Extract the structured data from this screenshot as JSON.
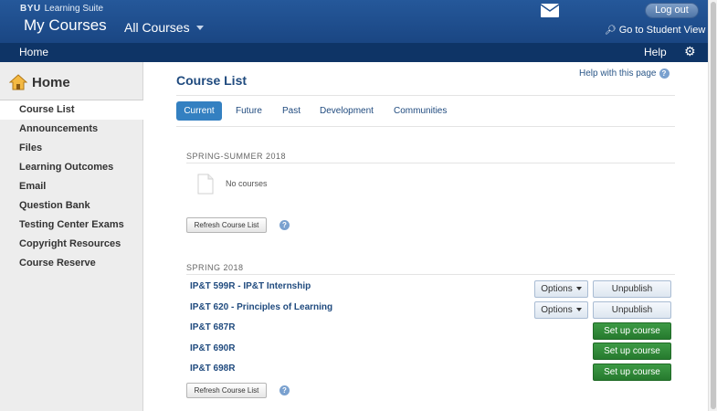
{
  "header": {
    "brand_org": "BYU",
    "brand_name": "Learning Suite",
    "app_title": "My Courses",
    "course_selector": "All Courses",
    "logout_label": "Log out",
    "student_view_label": "Go to Student View",
    "mail_icon": "mail-icon"
  },
  "subnav": {
    "home_label": "Home",
    "help_label": "Help",
    "settings_icon": "gear-icon"
  },
  "sidebar": {
    "title": "Home",
    "items": [
      {
        "label": "Course List",
        "active": true
      },
      {
        "label": "Announcements"
      },
      {
        "label": "Files"
      },
      {
        "label": "Learning Outcomes"
      },
      {
        "label": "Email"
      },
      {
        "label": "Question Bank"
      },
      {
        "label": "Testing Center Exams"
      },
      {
        "label": "Copyright Resources"
      },
      {
        "label": "Course Reserve"
      }
    ]
  },
  "main": {
    "title": "Course List",
    "help_link": "Help with this page",
    "tabs": [
      {
        "label": "Current",
        "active": true
      },
      {
        "label": "Future"
      },
      {
        "label": "Past"
      },
      {
        "label": "Development"
      },
      {
        "label": "Communities"
      }
    ],
    "sections": [
      {
        "heading": "SPRING-SUMMER 2018",
        "empty_text": "No courses",
        "refresh_label": "Refresh Course List"
      },
      {
        "heading": "SPRING 2018",
        "refresh_label": "Refresh Course List",
        "courses": [
          {
            "name": "IP&T 599R - IP&T Internship",
            "options_label": "Options",
            "action_label": "Unpublish"
          },
          {
            "name": "IP&T 620 - Principles of Learning",
            "options_label": "Options",
            "action_label": "Unpublish"
          },
          {
            "name": "IP&T 687R",
            "action_label": "Set up course"
          },
          {
            "name": "IP&T 690R",
            "action_label": "Set up course"
          },
          {
            "name": "IP&T 698R",
            "action_label": "Set up course"
          }
        ]
      }
    ]
  },
  "colors": {
    "header_blue": "#1f4f8f",
    "subnav_navy": "#0e3466",
    "active_tab": "#3480c1",
    "link_blue": "#1f4a7e",
    "setup_green": "#2e8a36"
  }
}
